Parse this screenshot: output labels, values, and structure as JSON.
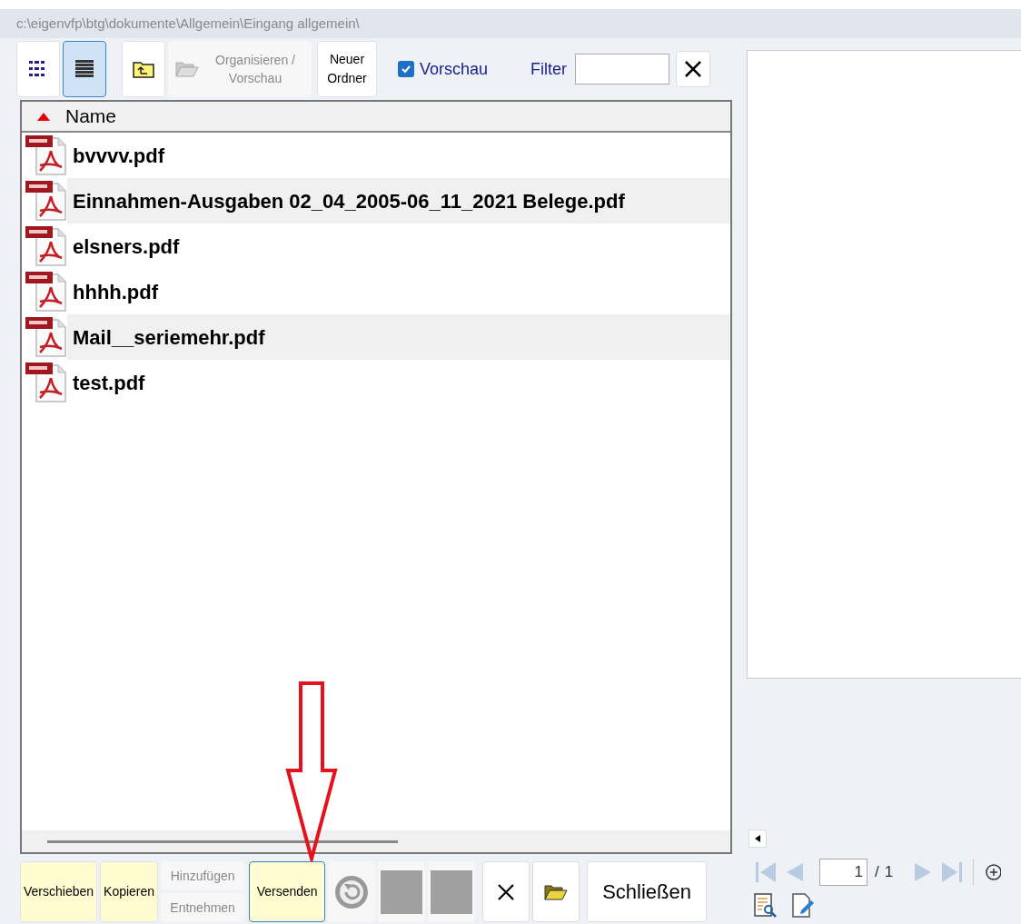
{
  "path": "c:\\eigenvfp\\btg\\dokumente\\Allgemein\\Eingang allgemein\\",
  "toolbar": {
    "view_buttons": [
      {
        "kind": "list",
        "selected": false
      },
      {
        "kind": "details",
        "selected": true
      }
    ],
    "organize_button": {
      "label": "Organisieren / Vorschau",
      "disabled": true
    },
    "new_folder_button": {
      "label": "Neuer Ordner"
    },
    "preview_checkbox": {
      "label": "Vorschau",
      "checked": true
    },
    "filter": {
      "label": "Filter"
    }
  },
  "file_list": {
    "column": {
      "label": "Name",
      "sorted_ascending": true
    },
    "rows": [
      {
        "name": "bvvvv.pdf",
        "highlighted": false
      },
      {
        "name": "Einnahmen-Ausgaben 02_04_2005-06_11_2021 Belege.pdf",
        "highlighted": true
      },
      {
        "name": "elsners.pdf",
        "highlighted": false
      },
      {
        "name": "hhhh.pdf",
        "highlighted": false
      },
      {
        "name": "Mail__seriemehr.pdf",
        "highlighted": true
      },
      {
        "name": "test.pdf",
        "highlighted": false
      }
    ]
  },
  "actions": [
    {
      "label": "Verschieben",
      "disabled": false,
      "focused": false
    },
    {
      "label": "Kopieren",
      "disabled": false,
      "focused": false
    }
  ],
  "stacked_actions": [
    {
      "label": "Hinzufügen",
      "disabled": true
    },
    {
      "label": "Entnehmen",
      "disabled": true
    }
  ],
  "send_button": {
    "label": "Versenden",
    "focused": true
  },
  "close_button": {
    "label": "Schließen"
  },
  "viewer": {
    "page": "1",
    "separator": "/",
    "page_count": "1"
  }
}
